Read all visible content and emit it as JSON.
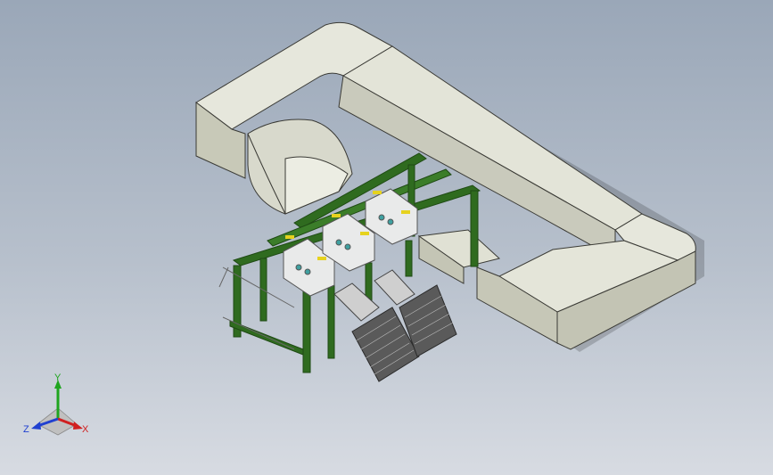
{
  "viewport": {
    "background_top": "#9aa7b8",
    "background_bottom": "#d7dbe2",
    "model": {
      "duct_color": "#dcddd0",
      "duct_edge": "#3a3a35",
      "frame_color": "#2f6b1f",
      "highlight_color": "#e6d21e",
      "panel_color": "#e9eaea",
      "stair_color": "#3c3c3c"
    }
  },
  "triad": {
    "x_label": "X",
    "y_label": "Y",
    "z_label": "Z",
    "x_color": "#d02020",
    "y_color": "#1fa51f",
    "z_color": "#2040d0"
  }
}
